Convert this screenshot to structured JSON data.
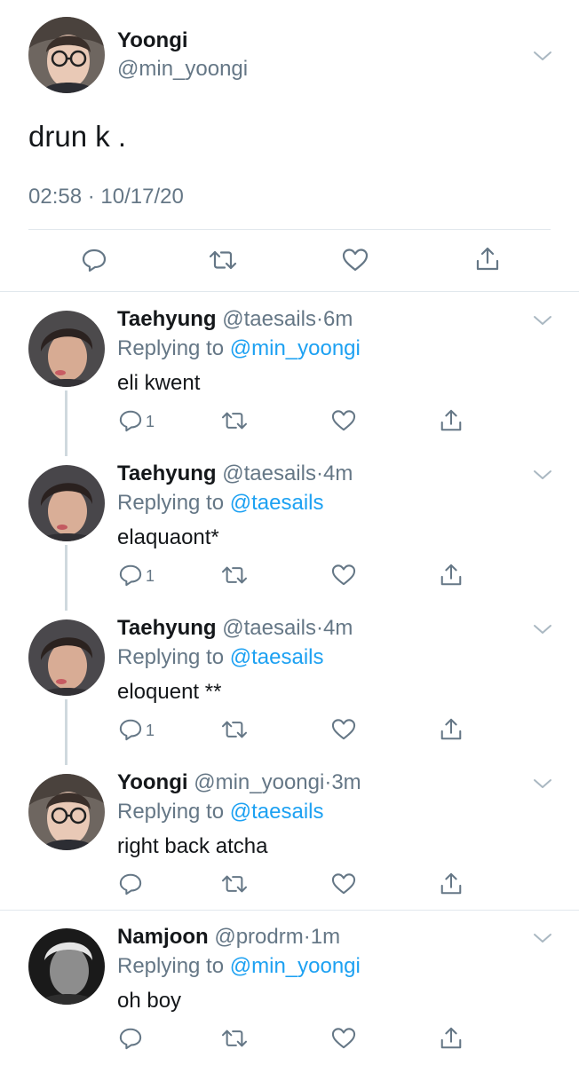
{
  "main_tweet": {
    "display_name": "Yoongi",
    "handle": "@min_yoongi",
    "text": "drun k .",
    "timestamp": "02:58 · 10/17/20",
    "icons": [
      "reply-icon",
      "retweet-icon",
      "like-icon",
      "share-icon",
      "chevron-down-icon"
    ]
  },
  "replies": [
    {
      "display_name": "Taehyung",
      "handle": "@taesails",
      "dot": "·",
      "time": "6m",
      "replying_prefix": "Replying to",
      "replying_to": "@min_yoongi",
      "text": "eli kwent",
      "reply_count": "1"
    },
    {
      "display_name": "Taehyung",
      "handle": "@taesails",
      "dot": "·",
      "time": "4m",
      "replying_prefix": "Replying to",
      "replying_to": "@taesails",
      "text": "elaquaont*",
      "reply_count": "1"
    },
    {
      "display_name": "Taehyung",
      "handle": "@taesails",
      "dot": "·",
      "time": "4m",
      "replying_prefix": "Replying to",
      "replying_to": "@taesails",
      "text": "eloquent **",
      "reply_count": "1"
    },
    {
      "display_name": "Yoongi",
      "handle": "@min_yoongi",
      "dot": "·",
      "time": "3m",
      "replying_prefix": "Replying to",
      "replying_to": "@taesails",
      "text": "right back atcha",
      "reply_count": ""
    },
    {
      "display_name": "Namjoon",
      "handle": "@prodrm",
      "dot": "·",
      "time": "1m",
      "replying_prefix": "Replying to",
      "replying_to": "@min_yoongi",
      "text": "oh boy",
      "reply_count": ""
    }
  ],
  "colors": {
    "text_primary": "#14171a",
    "text_secondary": "#657786",
    "link_blue": "#1da1f2",
    "divider": "#e1e8ed",
    "thread_line": "#cfd9de"
  }
}
